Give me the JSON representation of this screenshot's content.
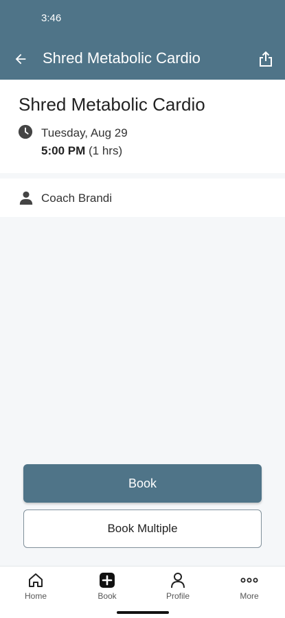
{
  "status": {
    "time": "3:46"
  },
  "appbar": {
    "title": "Shred Metabolic Cardio"
  },
  "class": {
    "title": "Shred Metabolic Cardio",
    "date": "Tuesday, Aug 29",
    "time": "5:00 PM",
    "duration": "(1 hrs)",
    "coach": "Coach Brandi"
  },
  "actions": {
    "book_label": "Book",
    "book_multiple_label": "Book Multiple"
  },
  "nav": {
    "items": [
      {
        "label": "Home",
        "icon": "home-icon"
      },
      {
        "label": "Book",
        "icon": "plus-square-icon"
      },
      {
        "label": "Profile",
        "icon": "person-icon"
      },
      {
        "label": "More",
        "icon": "more-horizontal-icon"
      }
    ]
  },
  "colors": {
    "primary": "#4f7488",
    "background": "#f5f7f9"
  }
}
